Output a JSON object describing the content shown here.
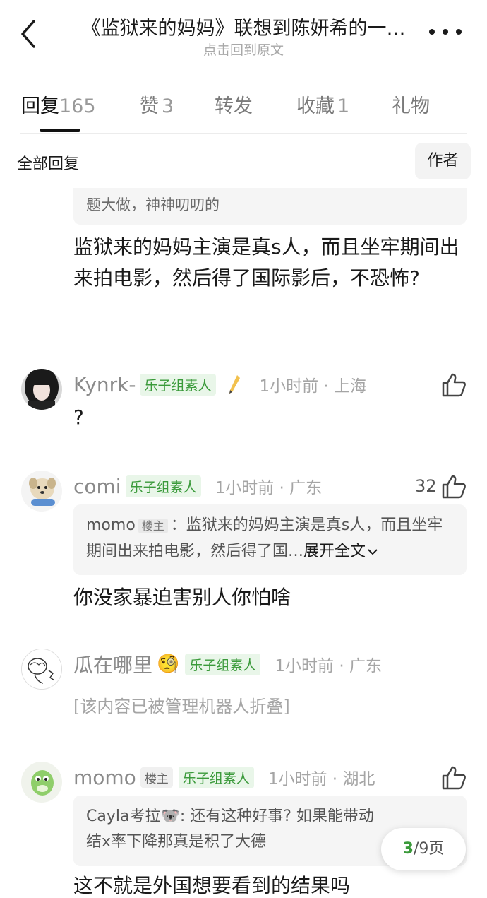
{
  "header": {
    "title": "《监狱来的妈妈》联想到陈妍希的一…",
    "subtitle": "点击回到原文"
  },
  "tabs": [
    {
      "label": "回复",
      "count": "165"
    },
    {
      "label": "赞",
      "count": "3"
    },
    {
      "label": "转发",
      "count": ""
    },
    {
      "label": "收藏",
      "count": "1"
    },
    {
      "label": "礼物",
      "count": ""
    }
  ],
  "filter": {
    "all_replies": "全部回复",
    "author": "作者"
  },
  "top_quote": "题大做，神神叨叨的",
  "main_text": "监狱来的妈妈主演是真s人，而且坐牢期间出来拍电影，然后得了国际影后，不恐怖?",
  "comments": [
    {
      "username": "Kynrk-",
      "badge": "乐子组素人",
      "extra_icon": "pencil-icon",
      "time": "1小时前 · 上海",
      "text": "?"
    },
    {
      "username": "comi",
      "badge": "乐子组素人",
      "time": "1小时前 · 广东",
      "likes": "32",
      "quote": {
        "name": "momo",
        "badge": "楼主",
        "text": "：监狱来的妈妈主演是真s人，而且坐牢期间出来拍电影，然后得了国…",
        "expand": "展开全文"
      },
      "text": "你没家暴迫害别人你怕啥"
    },
    {
      "username": "瓜在哪里",
      "emoji": "🧐",
      "badge": "乐子组素人",
      "time": "1小时前 · 广东",
      "text": "[该内容已被管理机器人折叠]"
    },
    {
      "username": "momo",
      "lz_badge": "楼主",
      "badge": "乐子组素人",
      "time": "1小时前 · 湖北",
      "quote": {
        "name": "Cayla考拉🐨",
        "text": ": 还有这种好事? 如果能带动结x率下降那真是积了大德"
      },
      "text": "这不就是外国想要看到的结果吗"
    }
  ],
  "pagination": {
    "current": "3",
    "total": "/9页"
  },
  "colors": {
    "accent_green": "#3a9a3a",
    "badge_bg": "#e9f6e9",
    "quote_bg": "#f5f5f5"
  }
}
